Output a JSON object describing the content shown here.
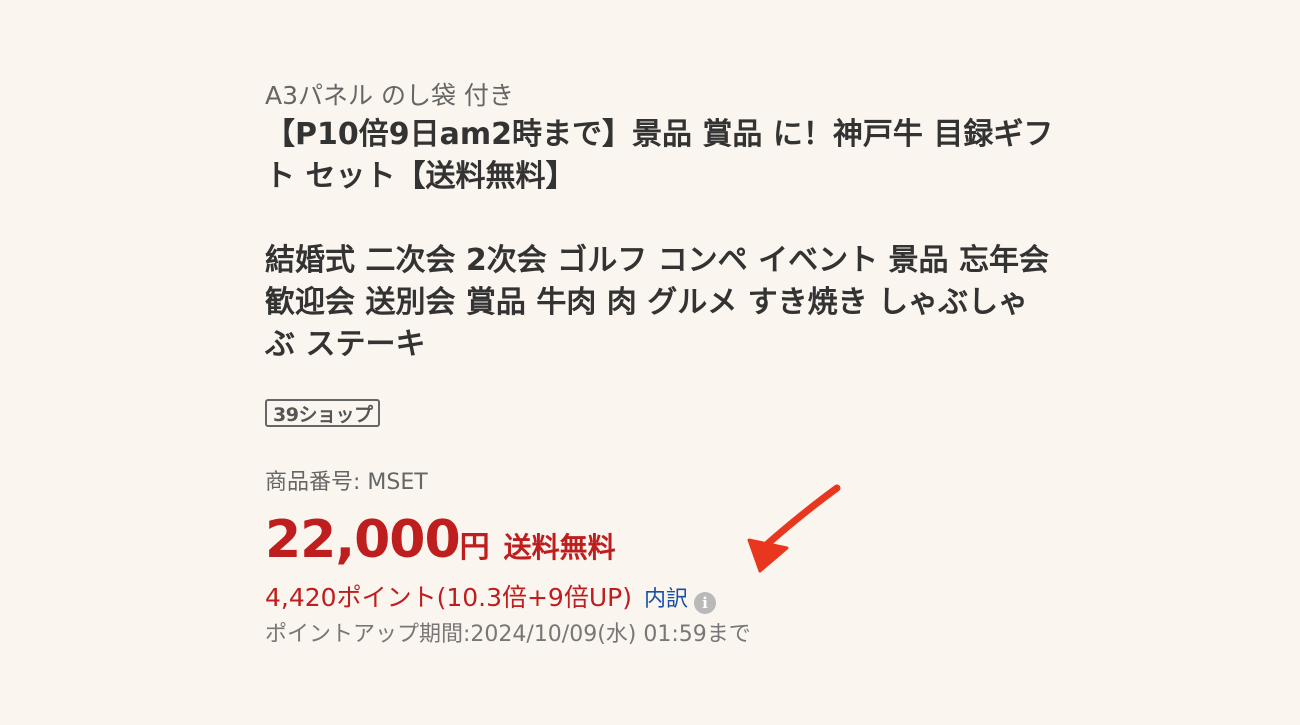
{
  "product": {
    "subtitle": "A3パネル のし袋 付き",
    "title": "【P10倍9日am2時まで】景品 賞品 に！神戸牛 目録ギフト セット【送料無料】\n\n結婚式 二次会 2次会 ゴルフ コンペ イベント 景品 忘年会 歓迎会 送別会 賞品 牛肉 肉 グルメ すき焼き しゃぶしゃぶ ステーキ",
    "shop_badge": "39ショップ",
    "item_number": "商品番号: MSET",
    "price": "22,000",
    "currency": "円",
    "shipping": "送料無料",
    "points": "4,420ポイント(10.3倍+9倍UP)",
    "breakdown_label": "内訳",
    "info_icon_glyph": "i",
    "point_period": "ポイントアップ期間:2024/10/09(水) 01:59まで"
  },
  "colors": {
    "background": "#fbf5ef",
    "price_red": "#bf1e1e",
    "link_blue": "#1a4fa3",
    "arrow_red": "#e8371e"
  },
  "icons": {
    "info": "info-icon",
    "annotation": "red-arrow-annotation"
  }
}
